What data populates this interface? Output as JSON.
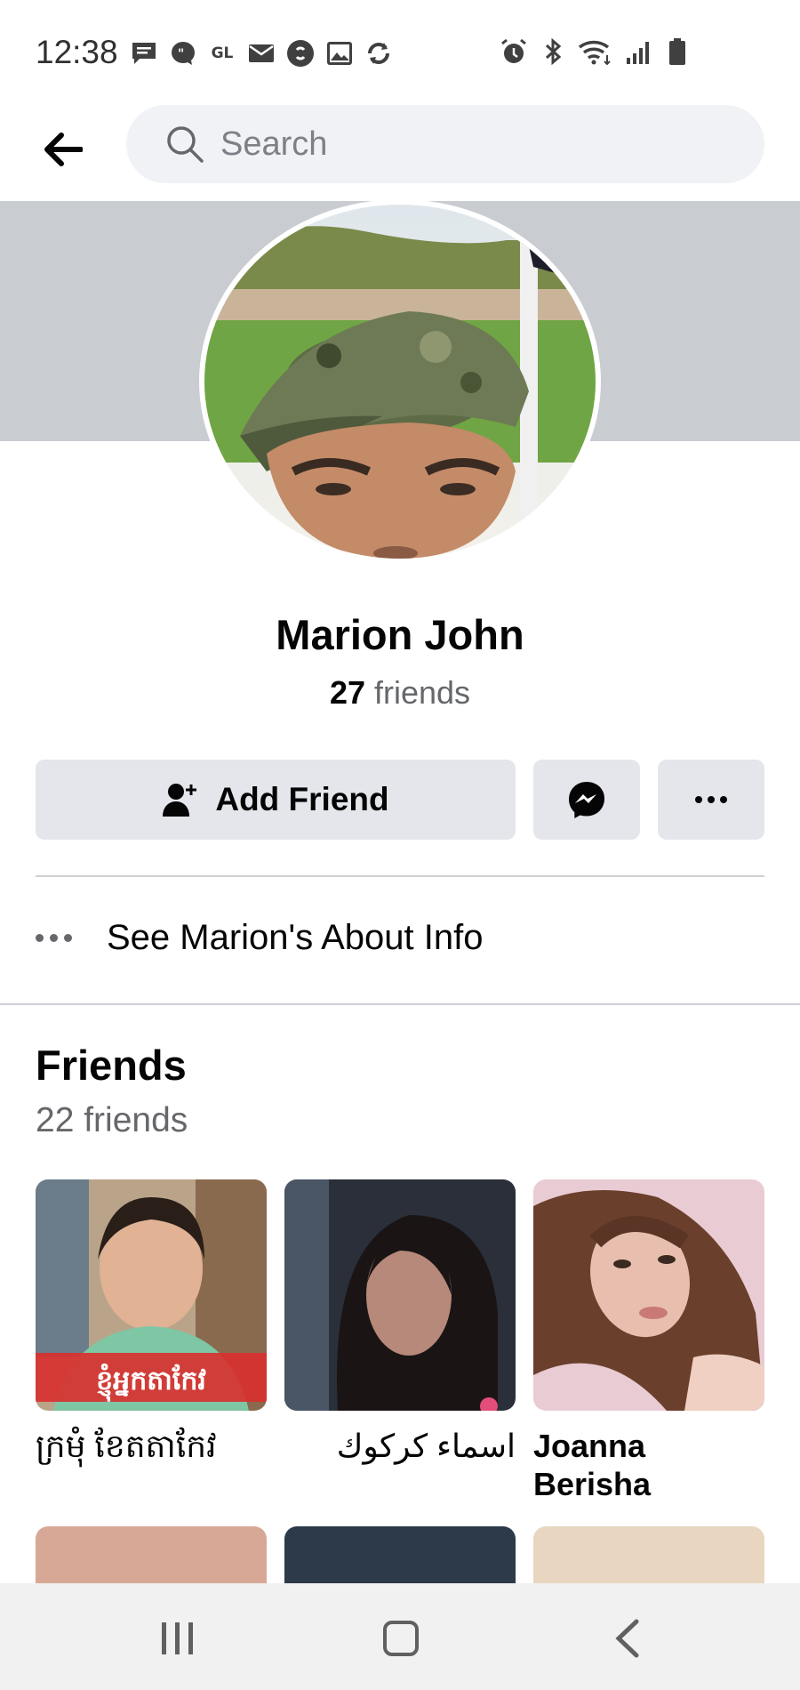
{
  "status_bar": {
    "time": "12:38",
    "left_icons": [
      "message-icon",
      "chat-bubble-icon",
      "gl-icon",
      "mail-icon",
      "shazam-icon",
      "gallery-icon",
      "sync-icon"
    ],
    "gl_text": "GL",
    "right_icons": [
      "alarm-icon",
      "bluetooth-icon",
      "wifi-icon",
      "signal-icon",
      "battery-icon"
    ]
  },
  "header": {
    "search_placeholder": "Search"
  },
  "profile": {
    "name": "Marion John",
    "friend_count_number": "27",
    "friend_count_label": "friends"
  },
  "actions": {
    "add_friend_label": "Add Friend"
  },
  "about": {
    "label": "See Marion's About Info"
  },
  "friends": {
    "title": "Friends",
    "subtitle": "22 friends",
    "items": [
      {
        "name": "ក្រមុំ ខែតតាកែវ",
        "photo_text": "ខ្ញុំអ្នកតាកែវ"
      },
      {
        "name": "اسماء كركوك"
      },
      {
        "name": "Joanna Berisha"
      }
    ]
  },
  "colors": {
    "button_bg": "#e4e6eb",
    "search_bg": "#f0f2f5",
    "cover_bg": "#c9ccd1",
    "secondary_text": "#65676b"
  }
}
